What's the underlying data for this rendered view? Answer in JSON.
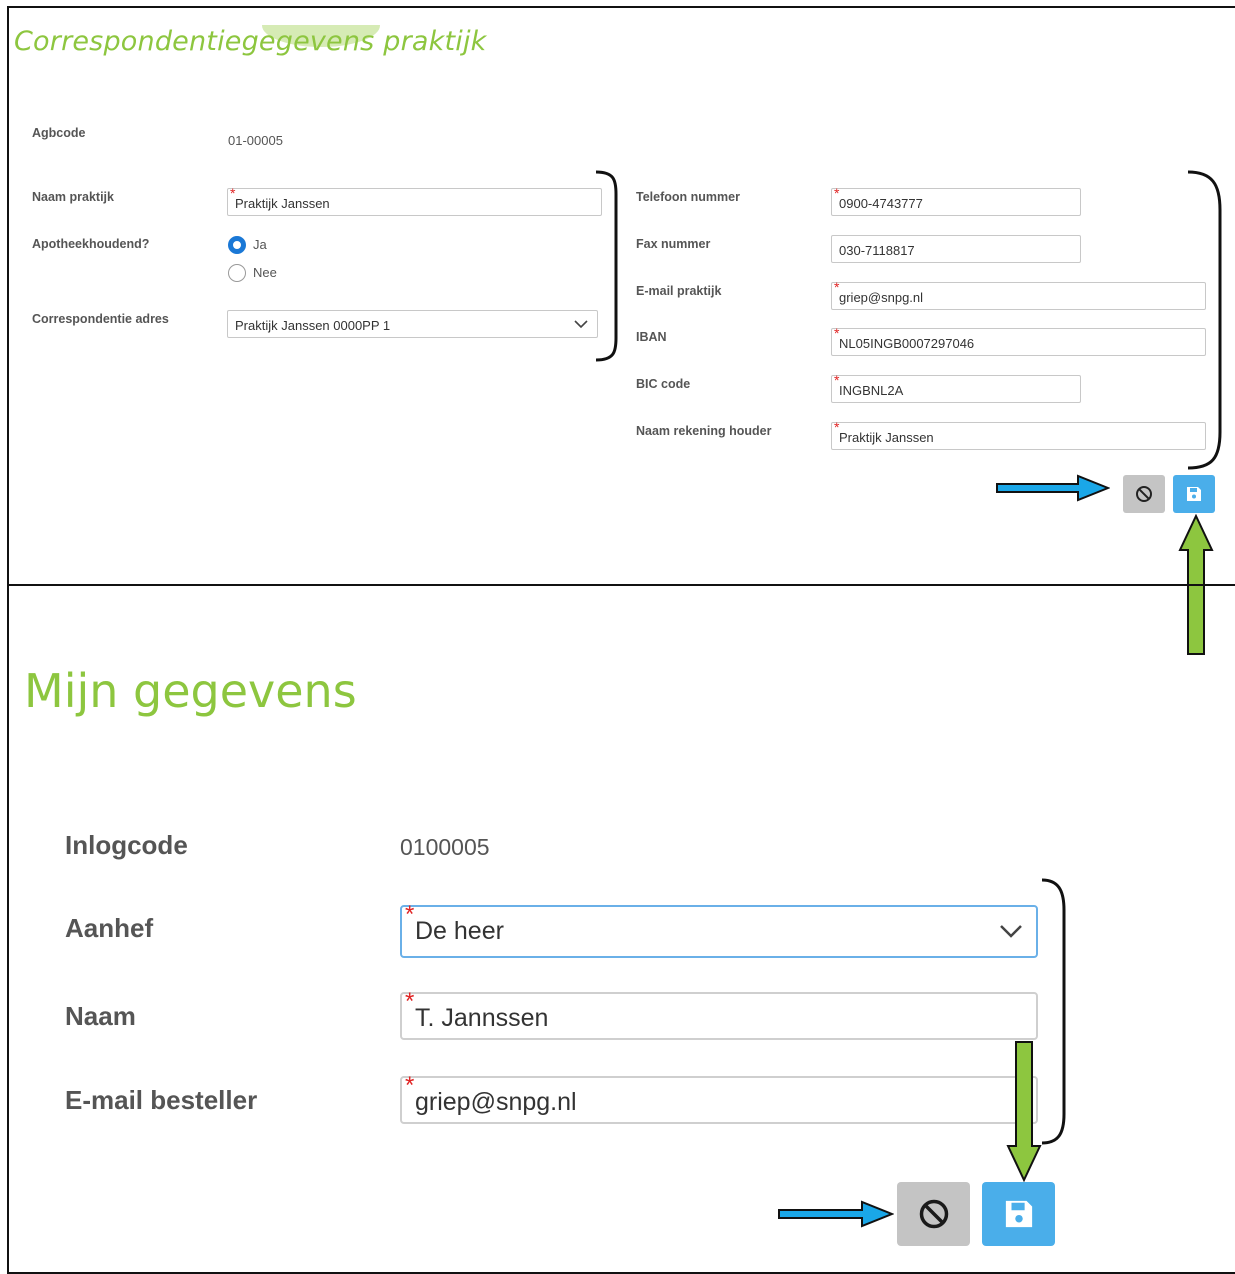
{
  "practice": {
    "title": "Correspondentiegegevens praktijk",
    "agbcode": {
      "label": "Agbcode",
      "value": "01-00005"
    },
    "naam_praktijk": {
      "label": "Naam praktijk",
      "value": "Praktijk Janssen"
    },
    "apotheekhoudend": {
      "label": "Apotheekhoudend?",
      "options": [
        "Ja",
        "Nee"
      ],
      "selected": "Ja"
    },
    "correspondentie_adres": {
      "label": "Correspondentie adres",
      "value": "Praktijk Janssen 0000PP 1"
    },
    "telefoon": {
      "label": "Telefoon nummer",
      "value": "0900-4743777"
    },
    "fax": {
      "label": "Fax nummer",
      "value": "030-7118817"
    },
    "email": {
      "label": "E-mail praktijk",
      "value": "griep@snpg.nl"
    },
    "iban": {
      "label": "IBAN",
      "value": "NL05INGB0007297046"
    },
    "bic": {
      "label": "BIC code",
      "value": "INGBNL2A"
    },
    "rekening_houder": {
      "label": "Naam rekening houder",
      "value": "Praktijk Janssen"
    },
    "required_mark": "*"
  },
  "mine": {
    "title": "Mijn gegevens",
    "inlogcode": {
      "label": "Inlogcode",
      "value": "0100005"
    },
    "aanhef": {
      "label": "Aanhef",
      "value": "De heer"
    },
    "naam": {
      "label": "Naam",
      "value": "T. Jannssen"
    },
    "email": {
      "label": "E-mail besteller",
      "value": "griep@snpg.nl"
    },
    "required_mark": "*"
  },
  "icons": {
    "cancel": "cancel-icon",
    "save": "save-icon"
  },
  "colors": {
    "title_green": "#8dc63f",
    "save_blue": "#4aaeea",
    "cancel_gray": "#c4c4c4",
    "arrow_blue": "#1aa7e8",
    "arrow_green": "#8dc63f",
    "required_red": "#e02424",
    "radio_blue": "#1a78d6"
  }
}
